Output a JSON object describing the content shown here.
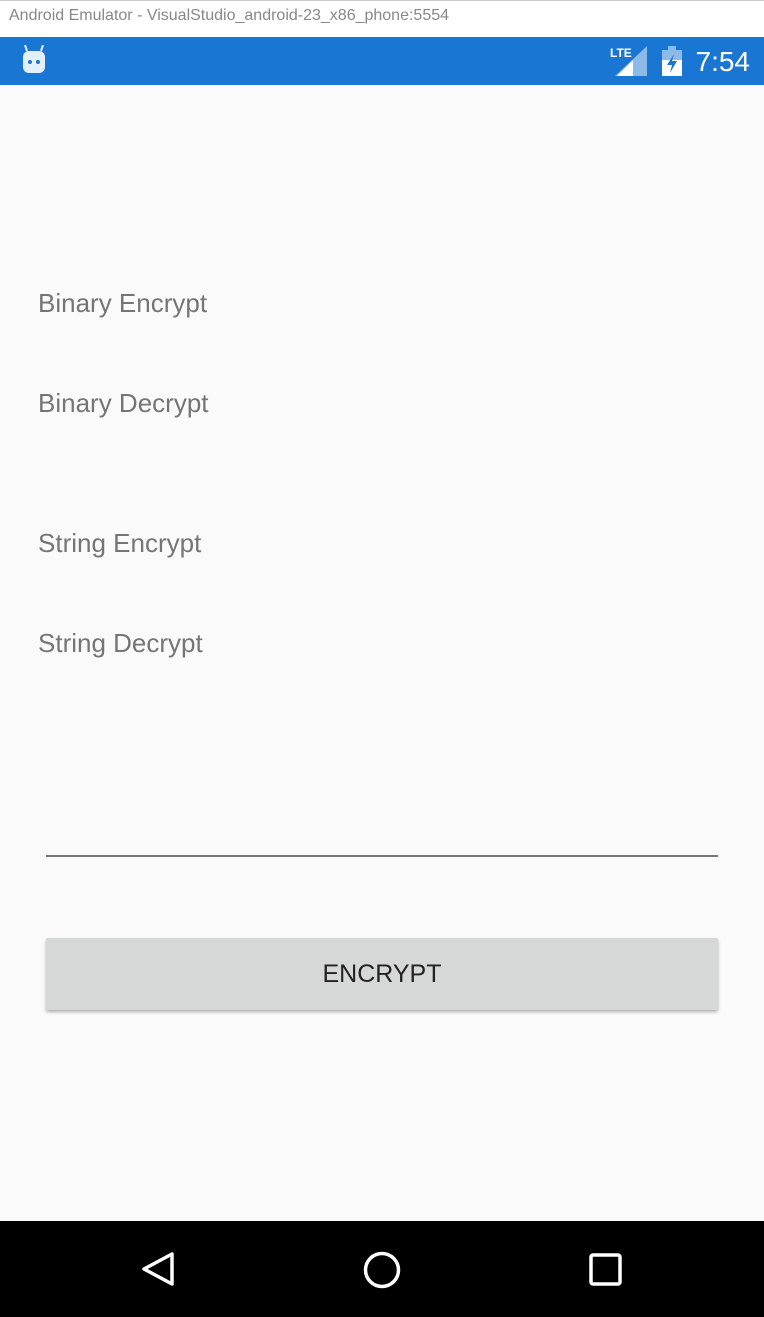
{
  "window": {
    "title": "Android Emulator - VisualStudio_android-23_x86_phone:5554"
  },
  "status_bar": {
    "network": "LTE",
    "time": "7:54"
  },
  "labels": {
    "binary_encrypt": "Binary Encrypt",
    "binary_decrypt": "Binary Decrypt",
    "string_encrypt": "String Encrypt",
    "string_decrypt": "String Decrypt"
  },
  "input": {
    "value": ""
  },
  "button": {
    "encrypt": "ENCRYPT"
  }
}
